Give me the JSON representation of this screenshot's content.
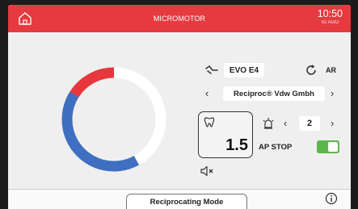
{
  "header": {
    "title": "MICROMOTOR",
    "time": "10:50",
    "date": "02 AGO",
    "home_icon": "home-icon",
    "color": "#e53a3f"
  },
  "speed_ring": {
    "red_fraction": 0.16,
    "blue_fraction": 0.42,
    "red_color": "#e8373c",
    "blue_color": "#3f6fc0",
    "track_color": "#ffffff"
  },
  "motor": {
    "name": "EVO E4",
    "icon": "handpiece-icon",
    "rotation_icon": "rotate-icon",
    "rotation_label": "AR"
  },
  "file_system": {
    "name": "Reciproc® Vdw Gmbh",
    "prev_icon": "chevron-left-icon",
    "next_icon": "chevron-right-icon"
  },
  "torque": {
    "icon": "tooth-icon",
    "value": "1.5"
  },
  "apex": {
    "icon": "apex-alarm-icon",
    "level": "2",
    "stop_label": "AP STOP",
    "stop_enabled": true,
    "toggle_color": "#5bb64a"
  },
  "sound": {
    "icon": "speaker-muted-icon"
  },
  "footer": {
    "mode_label": "Reciprocating Mode",
    "info_icon": "info-icon"
  }
}
